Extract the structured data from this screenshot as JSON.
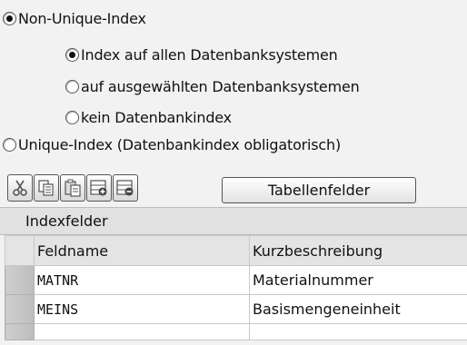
{
  "index_type": {
    "non_unique_label": "Non-Unique-Index",
    "non_unique_selected": true,
    "sub_options": [
      {
        "label": "Index auf allen Datenbanksystemen",
        "selected": true
      },
      {
        "label": "auf ausgewählten Datenbanksystemen",
        "selected": false
      },
      {
        "label": "kein Datenbankindex",
        "selected": false
      }
    ],
    "unique_label": "Unique-Index (Datenbankindex obligatorisch)",
    "unique_selected": false
  },
  "toolbar": {
    "icons": [
      "cut-icon",
      "copy-icon",
      "paste-icon",
      "insert-row-icon",
      "delete-row-icon"
    ],
    "table_fields_label": "Tabellenfelder"
  },
  "grid": {
    "title": "Indexfelder",
    "columns": [
      "Feldname",
      "Kurzbeschreibung"
    ],
    "rows": [
      {
        "field": "MATNR",
        "desc": "Materialnummer"
      },
      {
        "field": "MEINS",
        "desc": "Basismengeneinheit"
      },
      {
        "field": "",
        "desc": ""
      }
    ]
  }
}
